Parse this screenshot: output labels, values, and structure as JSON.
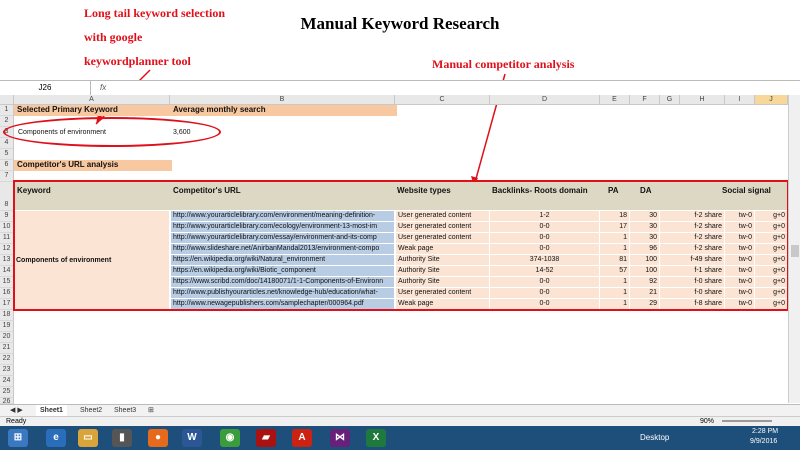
{
  "title": "Manual Keyword Research",
  "annotations": {
    "left": [
      "Long tail keyword selection",
      "with google",
      "keywordplanner tool"
    ],
    "right": "Manual competitor analysis"
  },
  "formula_bar": {
    "cell_ref": "J26",
    "fx": "fx"
  },
  "columns": [
    "A",
    "B",
    "C",
    "D",
    "E",
    "F",
    "G",
    "H",
    "I",
    "J"
  ],
  "rows": [
    "1",
    "2",
    "3",
    "4",
    "5",
    "6",
    "7",
    "8",
    "9",
    "10",
    "11",
    "12",
    "13",
    "14",
    "15",
    "16",
    "17",
    "18",
    "19",
    "20",
    "21",
    "22",
    "23",
    "24",
    "25",
    "26"
  ],
  "sheet": {
    "selected_primary_keyword_label": "Selected Primary Keyword",
    "avg_monthly_search_label": "Average monthly search",
    "keyword_value": "Components of environment",
    "search_value": "3,600",
    "competitor_url_analysis": "Competitor's URL analysis",
    "table_headers": {
      "keyword": "Keyword",
      "url": "Competitor's URL",
      "website_types": "Website types",
      "backlinks": "Backlinks- Roots domain",
      "pa": "PA",
      "da": "DA",
      "social": "Social signal"
    },
    "table_keyword": "Components of environment",
    "table_rows": [
      {
        "url": "http://www.yourarticlelibrary.com/environment/meaning-definition-",
        "type": "User generated content",
        "backlinks": "1-2",
        "pa": "18",
        "da": "30",
        "f": "f-2 share",
        "tw": "tw-0",
        "g": "g+0"
      },
      {
        "url": "http://www.yourarticlelibrary.com/ecology/environment-13-most-im",
        "type": "User generated content",
        "backlinks": "0-0",
        "pa": "17",
        "da": "30",
        "f": "f-2 share",
        "tw": "tw-0",
        "g": "g+0"
      },
      {
        "url": "http://www.yourarticlelibrary.com/essay/environment-and-its-comp",
        "type": "User generated content",
        "backlinks": "0-0",
        "pa": "1",
        "da": "30",
        "f": "f-2 share",
        "tw": "tw-0",
        "g": "g+0"
      },
      {
        "url": "http://www.slideshare.net/AnirbanMandal2013/environment-compo",
        "type": "Weak page",
        "backlinks": "0-0",
        "pa": "1",
        "da": "96",
        "f": "f-2 share",
        "tw": "tw-0",
        "g": "g+0"
      },
      {
        "url": "https://en.wikipedia.org/wiki/Natural_environment",
        "type": "Authority Site",
        "backlinks": "374-1038",
        "pa": "81",
        "da": "100",
        "f": "f-49 share",
        "tw": "tw-0",
        "g": "g+0"
      },
      {
        "url": "https://en.wikipedia.org/wiki/Biotic_component",
        "type": "Authority Site",
        "backlinks": "14-52",
        "pa": "57",
        "da": "100",
        "f": "f-1 share",
        "tw": "tw-0",
        "g": "g+0"
      },
      {
        "url": "https://www.scribd.com/doc/14180071/1-1-Components-of-Environn",
        "type": "Authority Site",
        "backlinks": "0-0",
        "pa": "1",
        "da": "92",
        "f": "f-0 share",
        "tw": "tw-0",
        "g": "g+0"
      },
      {
        "url": "http://www.publishyourarticles.net/knowledge-hub/education/what-",
        "type": "User generated content",
        "backlinks": "0-0",
        "pa": "1",
        "da": "21",
        "f": "f-0 share",
        "tw": "tw-0",
        "g": "g+0"
      },
      {
        "url": "http://www.newagepublishers.com/samplechapter/000964.pdf",
        "type": "Weak page",
        "backlinks": "0-0",
        "pa": "1",
        "da": "29",
        "f": "f-8 share",
        "tw": "tw-0",
        "g": "g+0"
      }
    ]
  },
  "sheet_tabs": [
    "Sheet1",
    "Sheet2",
    "Sheet3"
  ],
  "status": {
    "ready": "Ready",
    "zoom": "90%"
  },
  "taskbar": {
    "desktop": "Desktop",
    "time": "2:28 PM",
    "date": "9/9/2016"
  },
  "colors": {
    "accent_red": "#e0101a",
    "orange": "#f8c8a0",
    "peach": "#fbe4d4",
    "blue": "#b8cce4",
    "tan": "#ddd8c4"
  }
}
